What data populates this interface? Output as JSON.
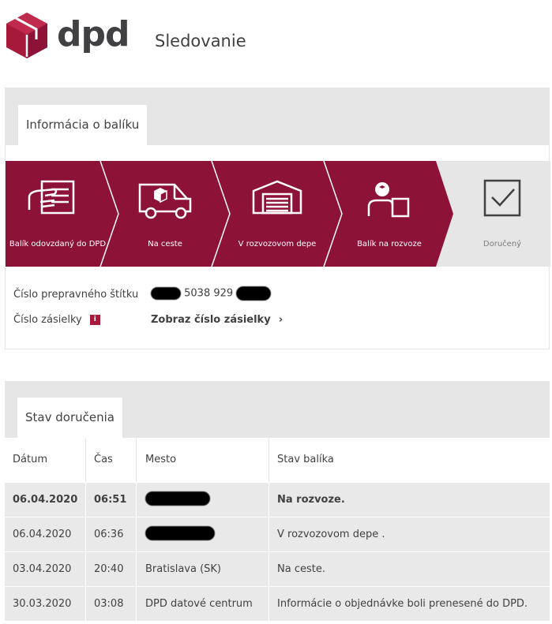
{
  "header": {
    "logo_text": "dpd",
    "page_title": "Sledovanie"
  },
  "package_panel": {
    "tab_label": "Informácia o balíku",
    "steps": [
      {
        "label": "Balík odovzdaný do DPD",
        "icon": "hand-document-icon",
        "state": "complete"
      },
      {
        "label": "Na ceste",
        "icon": "delivery-van-icon",
        "state": "complete"
      },
      {
        "label": "V rozvozovom depe",
        "icon": "depot-garage-icon",
        "state": "complete"
      },
      {
        "label": "Balík na rozvoze",
        "icon": "courier-parcel-icon",
        "state": "complete"
      },
      {
        "label": "Doručený",
        "icon": "checkbox-check-icon",
        "state": "pending"
      }
    ],
    "label_number_label": "Číslo prepravného štítku",
    "label_number_value": "5038 929",
    "shipment_number_label": "Číslo zásielky",
    "shipment_info_badge": "i",
    "show_shipment_link": "Zobraz číslo zásielky",
    "show_shipment_chevron": "›"
  },
  "delivery_panel": {
    "tab_label": "Stav doručenia",
    "columns": {
      "date": "Dátum",
      "time": "Čas",
      "city": "Mesto",
      "status": "Stav balíka"
    },
    "rows": [
      {
        "date": "06.04.2020",
        "time": "06:51",
        "city": "",
        "status": "Na rozvoze.",
        "bold": true
      },
      {
        "date": "06.04.2020",
        "time": "06:36",
        "city": "",
        "status": "V rozvozovom depe .",
        "bold": false
      },
      {
        "date": "03.04.2020",
        "time": "20:40",
        "city": "Bratislava (SK)",
        "status": "Na ceste.",
        "bold": false
      },
      {
        "date": "30.03.2020",
        "time": "03:08",
        "city": "DPD datové centrum",
        "status": "Informácie o objednávke boli prenesené do DPD.",
        "bold": false
      }
    ]
  },
  "colors": {
    "brand": "#a6193b",
    "step_active": "#8c1238",
    "step_pending": "#e6e6e6",
    "band": "#e6e6e6",
    "row": "#e9e9e9",
    "text": "#414042"
  }
}
